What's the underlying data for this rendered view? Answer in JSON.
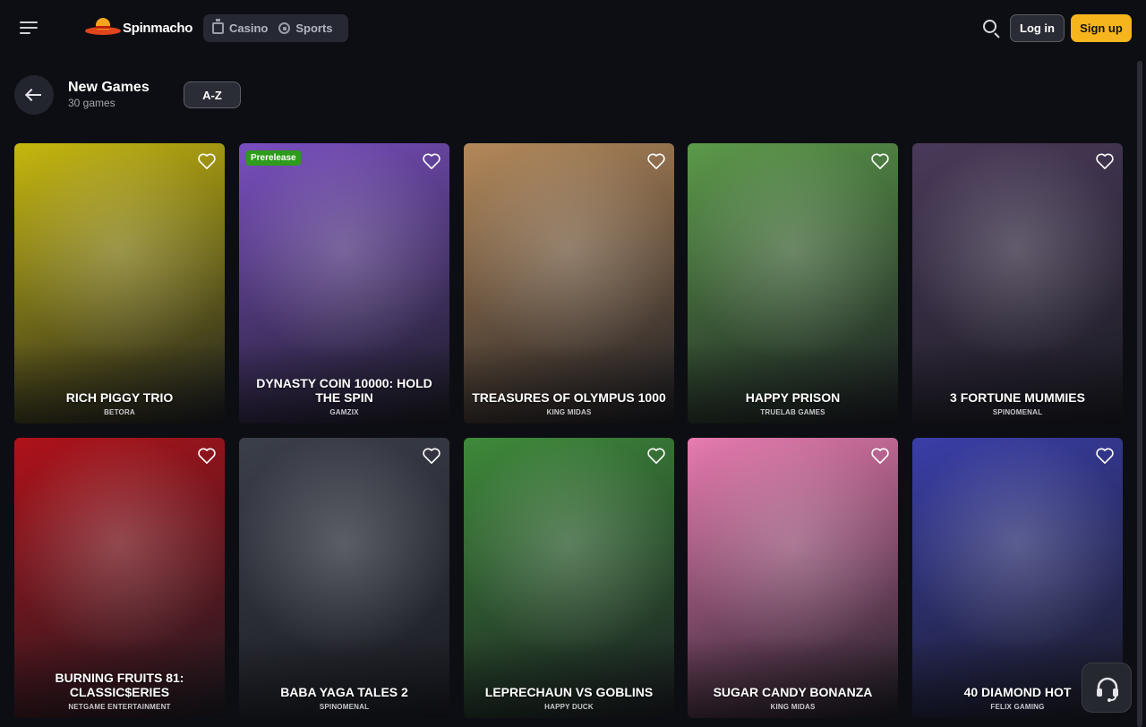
{
  "header": {
    "brand": "Spinmacho",
    "tabs": [
      {
        "label": "Casino",
        "icon": "casino-icon"
      },
      {
        "label": "Sports",
        "icon": "soccer-ball-icon"
      }
    ],
    "login_label": "Log in",
    "signup_label": "Sign up"
  },
  "section": {
    "title": "New Games",
    "count": "30 games",
    "sort_label": "A-Z"
  },
  "games": [
    {
      "title": "RICH PIGGY TRIO",
      "provider": "BETORA",
      "badge": "",
      "bg": "#c7b80e"
    },
    {
      "title": "DYNASTY COIN 10000: HOLD THE SPIN",
      "provider": "GAMZIX",
      "badge": "Prerelease",
      "bg": "#7a4fc0"
    },
    {
      "title": "TREASURES OF OLYMPUS 1000",
      "provider": "KING MIDAS",
      "badge": "",
      "bg": "#b4895a"
    },
    {
      "title": "HAPPY PRISON",
      "provider": "TRUELAB GAMES",
      "badge": "",
      "bg": "#5c9a4a"
    },
    {
      "title": "3 FORTUNE MUMMIES",
      "provider": "SPINOMENAL",
      "badge": "",
      "bg": "#4a3a5a"
    },
    {
      "title": "BURNING FRUITS 81: CLASSIC$ERIES",
      "provider": "NETGAME ENTERTAINMENT",
      "badge": "",
      "bg": "#b0121a"
    },
    {
      "title": "BABA YAGA TALES 2",
      "provider": "SPINOMENAL",
      "badge": "",
      "bg": "#3b3f4a"
    },
    {
      "title": "LEPRECHAUN VS GOBLINS",
      "provider": "HAPPY DUCK",
      "badge": "",
      "bg": "#3e8a3a"
    },
    {
      "title": "SUGAR CANDY BONANZA",
      "provider": "KING MIDAS",
      "badge": "",
      "bg": "#e87bb0"
    },
    {
      "title": "40 DIAMOND HOT",
      "provider": "FELIX GAMING",
      "badge": "",
      "bg": "#3a3ea8"
    }
  ]
}
